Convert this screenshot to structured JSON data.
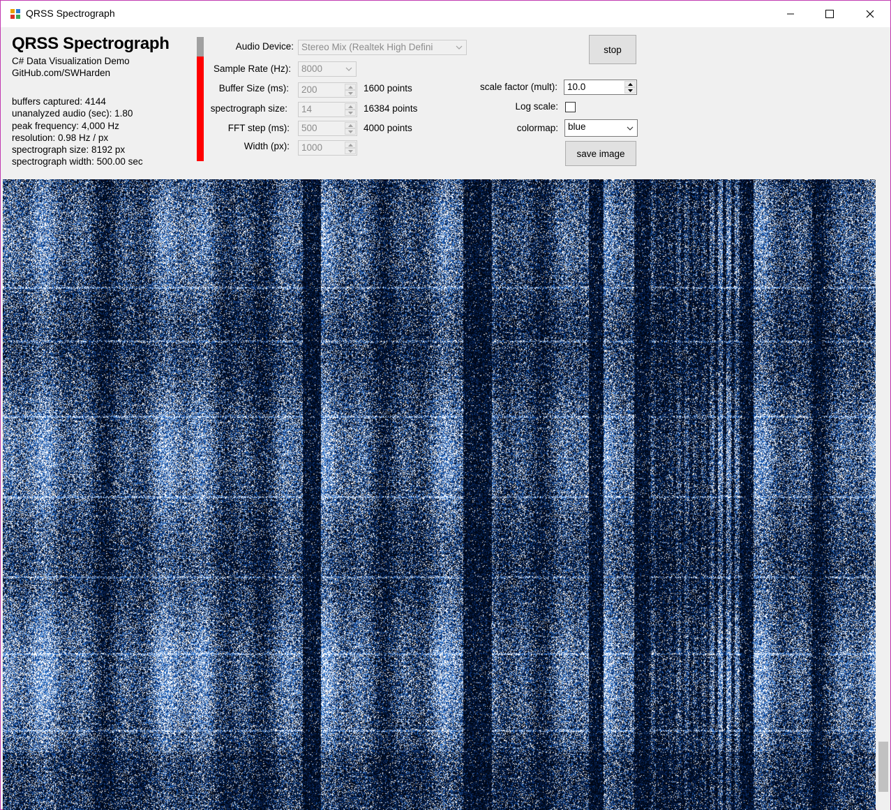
{
  "window": {
    "title": "QRSS Spectrograph",
    "minimize_glyph": "—",
    "maximize_glyph": "☐",
    "close_glyph": "✕"
  },
  "info": {
    "app_title": "QRSS Spectrograph",
    "subtitle": "C# Data Visualization Demo",
    "github": "GitHub.com/SWHarden",
    "stats": [
      "buffers captured:  4144",
      "unanalyzed audio (sec):  1.80",
      "peak frequency: 4,000 Hz",
      "resolution:  0.98 Hz / px",
      "spectrograph size:  8192 px",
      "spectrograph width: 500.00 sec"
    ]
  },
  "level_meter": {
    "level": 0.84,
    "color": "#ff0000"
  },
  "settings": {
    "audio_device_label": "Audio Device:",
    "audio_device_value": "Stereo Mix (Realtek High Defini",
    "sample_rate_label": "Sample Rate (Hz):",
    "sample_rate_value": "8000",
    "buffer_size_label": "Buffer Size (ms):",
    "buffer_size_value": "200",
    "buffer_size_points": "1600 points",
    "spectro_size_label": "spectrograph size:",
    "spectro_size_value": "14",
    "spectro_size_points": "16384 points",
    "fft_step_label": "FFT step (ms):",
    "fft_step_value": "500",
    "fft_step_points": "4000 points",
    "width_label": "Width (px):",
    "width_value": "1000"
  },
  "controls": {
    "stop_label": "stop",
    "scale_factor_label": "scale factor (mult):",
    "scale_factor_value": "10.0",
    "log_scale_label": "Log scale:",
    "log_scale_checked": false,
    "colormap_label": "colormap:",
    "colormap_value": "blue",
    "save_image_label": "save image"
  },
  "spectrogram": {
    "colormap": "blue",
    "accent": "#0a4ea8"
  },
  "scrollbar": {
    "position": 1.0
  }
}
